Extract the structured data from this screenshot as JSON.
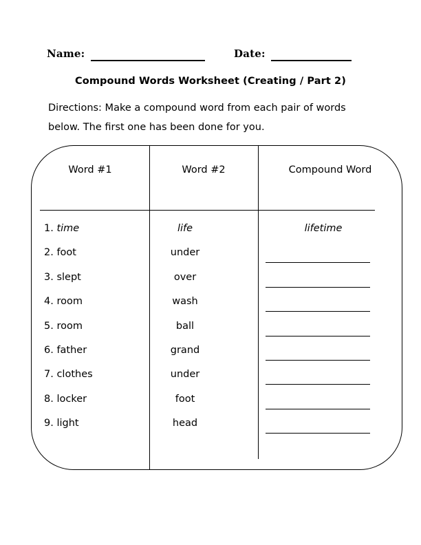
{
  "header": {
    "name_label": "Name:",
    "date_label": "Date:",
    "name_value": "",
    "date_value": ""
  },
  "title": "Compound Words Worksheet (Creating / Part 2)",
  "directions": "Directions: Make a compound word from each pair of words below. The first one has been done for you.",
  "table": {
    "columns": [
      "Word #1",
      "Word #2",
      "Compound Word"
    ],
    "rows": [
      {
        "number": "1.",
        "word1": "time",
        "word2": "life",
        "answer": "lifetime",
        "filled": true
      },
      {
        "number": "2.",
        "word1": "foot",
        "word2": "under",
        "answer": "",
        "filled": false
      },
      {
        "number": "3.",
        "word1": "slept",
        "word2": "over",
        "answer": "",
        "filled": false
      },
      {
        "number": "4.",
        "word1": "room",
        "word2": "wash",
        "answer": "",
        "filled": false
      },
      {
        "number": "5.",
        "word1": "room",
        "word2": "ball",
        "answer": "",
        "filled": false
      },
      {
        "number": "6.",
        "word1": "father",
        "word2": "grand",
        "answer": "",
        "filled": false
      },
      {
        "number": "7.",
        "word1": "clothes",
        "word2": "under",
        "answer": "",
        "filled": false
      },
      {
        "number": "8.",
        "word1": "locker",
        "word2": "foot",
        "answer": "",
        "filled": false
      },
      {
        "number": "9.",
        "word1": "light",
        "word2": "head",
        "answer": "",
        "filled": false
      }
    ]
  },
  "colors": {
    "ink": "#000000",
    "paper": "#ffffff"
  }
}
